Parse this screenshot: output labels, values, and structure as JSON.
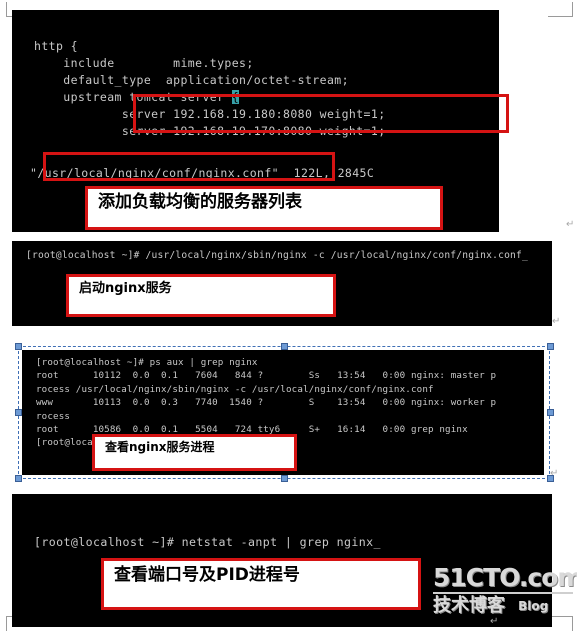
{
  "document": {
    "watermark": {
      "main": "51CTO.com",
      "sub": "技术博客",
      "blog": "Blog"
    },
    "paragraph_mark": "↵"
  },
  "terminals": [
    {
      "id": "vim-nginx-conf",
      "kind": "vim-editor",
      "code_lines": [
        "http {",
        "    include        mime.types;",
        "    default_type  application/octet-stream;",
        "    upstream tomcat server ",
        "            server 192.168.19.180:8080 weight=1;",
        "            server 192.168.19.170:8080 weight=1;"
      ],
      "cursor_char": "{",
      "status_line": "\"/usr/local/nginx/conf/nginx.conf\"  122L, 2845C",
      "file_path": "/usr/local/nginx/conf/nginx.conf",
      "file_lines": "122L",
      "file_chars": "2845C"
    },
    {
      "id": "start-nginx",
      "kind": "shell",
      "prompt": "[root@localhost ~]#",
      "command": "/usr/local/nginx/sbin/nginx -c /usr/local/nginx/conf/nginx.conf",
      "full_line": "[root@localhost ~]# /usr/local/nginx/sbin/nginx -c /usr/local/nginx/conf/nginx.conf_"
    },
    {
      "id": "ps-aux-nginx",
      "kind": "shell",
      "prompt": "[root@localhost ~]#",
      "command": "ps aux | grep nginx",
      "output_lines": [
        "[root@localhost ~]# ps aux | grep nginx",
        "root      10112  0.0  0.1   7604   844 ?        Ss   13:54   0:00 nginx: master p",
        "rocess /usr/local/nginx/sbin/nginx -c /usr/local/nginx/conf/nginx.conf",
        "www       10113  0.0  0.3   7740  1540 ?        S    13:54   0:00 nginx: worker p",
        "rocess",
        "root      10586  0.0  0.1   5504   724 tty6     S+   16:14   0:00 grep nginx",
        "[root@localhost ~]# _"
      ],
      "processes": [
        {
          "user": "root",
          "pid": "10112",
          "cpu": "0.0",
          "mem": "0.1",
          "vsz": "7604",
          "rss": "844",
          "tty": "?",
          "stat": "Ss",
          "start": "13:54",
          "time": "0:00",
          "command": "nginx: master process /usr/local/nginx/sbin/nginx -c /usr/local/nginx/conf/nginx.conf"
        },
        {
          "user": "www",
          "pid": "10113",
          "cpu": "0.0",
          "mem": "0.3",
          "vsz": "7740",
          "rss": "1540",
          "tty": "?",
          "stat": "S",
          "start": "13:54",
          "time": "0:00",
          "command": "nginx: worker process"
        },
        {
          "user": "root",
          "pid": "10586",
          "cpu": "0.0",
          "mem": "0.1",
          "vsz": "5504",
          "rss": "724",
          "tty": "tty6",
          "stat": "S+",
          "start": "16:14",
          "time": "0:00",
          "command": "grep nginx"
        }
      ]
    },
    {
      "id": "netstat-nginx",
      "kind": "shell",
      "prompt": "[root@localhost ~]#",
      "command": "netstat -anpt | grep nginx",
      "full_line": "[root@localhost ~]# netstat -anpt | grep nginx_"
    }
  ],
  "annotations": [
    {
      "id": "annotation-1",
      "text": "添加负载均衡的服务器列表"
    },
    {
      "id": "annotation-2",
      "text": "启动nginx服务"
    },
    {
      "id": "annotation-3",
      "text": "查看nginx服务进程"
    },
    {
      "id": "annotation-4",
      "text": "查看端口号及PID进程号"
    }
  ],
  "highlights": [
    {
      "id": "highlight-server-list",
      "target": "upstream server entries"
    },
    {
      "id": "highlight-config-path",
      "target": "/usr/local/nginx/conf/nginx.conf"
    }
  ],
  "colors": {
    "highlight_red": "#d51313",
    "terminal_bg": "#000000",
    "terminal_fg": "#c8c8c8",
    "vim_cursor": "#36a0a8",
    "selection_handle": "#6d9ad4"
  }
}
